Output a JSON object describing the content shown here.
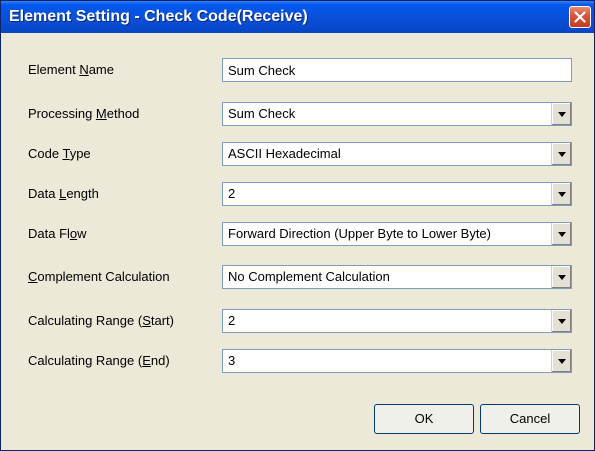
{
  "window": {
    "title": "Element Setting - Check Code(Receive)",
    "close_icon": "close-x-icon"
  },
  "fields": [
    {
      "label_pre": "Element ",
      "label_key": "N",
      "label_post": "ame",
      "value": "Sum Check",
      "type": "text"
    },
    {
      "label_pre": "Processing ",
      "label_key": "M",
      "label_post": "ethod",
      "value": "Sum Check",
      "type": "select"
    },
    {
      "label_pre": "Code ",
      "label_key": "T",
      "label_post": "ype",
      "value": "ASCII Hexadecimal",
      "type": "select"
    },
    {
      "label_pre": "Data ",
      "label_key": "L",
      "label_post": "ength",
      "value": "2",
      "type": "select"
    },
    {
      "label_pre": "Data Fl",
      "label_key": "o",
      "label_post": "w",
      "value": "Forward Direction (Upper Byte to Lower Byte)",
      "type": "select"
    },
    {
      "label_pre": "",
      "label_key": "C",
      "label_post": "omplement Calculation",
      "value": "No Complement Calculation",
      "type": "select"
    },
    {
      "label_pre": "Calculating Range (",
      "label_key": "S",
      "label_post": "tart)",
      "value": "2",
      "type": "select"
    },
    {
      "label_pre": "Calculating Range (",
      "label_key": "E",
      "label_post": "nd)",
      "value": "3",
      "type": "select"
    }
  ],
  "buttons": {
    "ok": "OK",
    "cancel": "Cancel"
  }
}
